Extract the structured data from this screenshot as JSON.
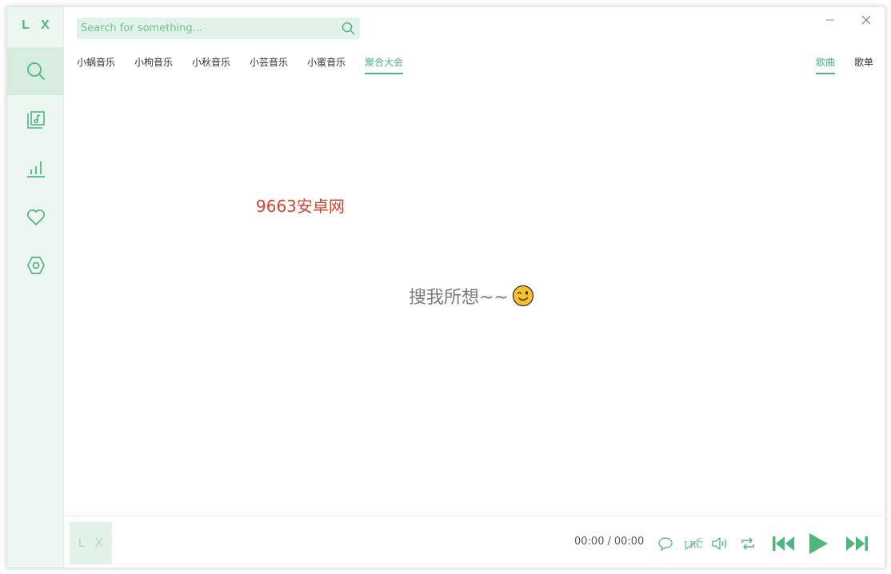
{
  "app": {
    "logo": "L X"
  },
  "search": {
    "placeholder": "Search for something..."
  },
  "sources": [
    "小蜗音乐",
    "小枸音乐",
    "小秋音乐",
    "小芸音乐",
    "小蜜音乐",
    "聚合大会"
  ],
  "active_source": "聚合大会",
  "types": [
    "歌曲",
    "歌单"
  ],
  "active_type": "歌曲",
  "watermark": "9663安卓网",
  "empty_message": "搜我所想~~",
  "player": {
    "cover_text": "L X",
    "current_time": "00:00",
    "separator": "/",
    "total_time": "00:00"
  },
  "colors": {
    "accent": "#4fb680",
    "sidebar_bg": "#edf7f1",
    "watermark": "#d2442c"
  },
  "icons": {
    "sidebar": [
      "search-icon",
      "music-library-icon",
      "chart-icon",
      "heart-icon",
      "settings-icon"
    ],
    "player": [
      "comment-icon",
      "lyrics-icon",
      "volume-icon",
      "repeat-icon",
      "previous-icon",
      "play-icon",
      "next-icon"
    ]
  }
}
